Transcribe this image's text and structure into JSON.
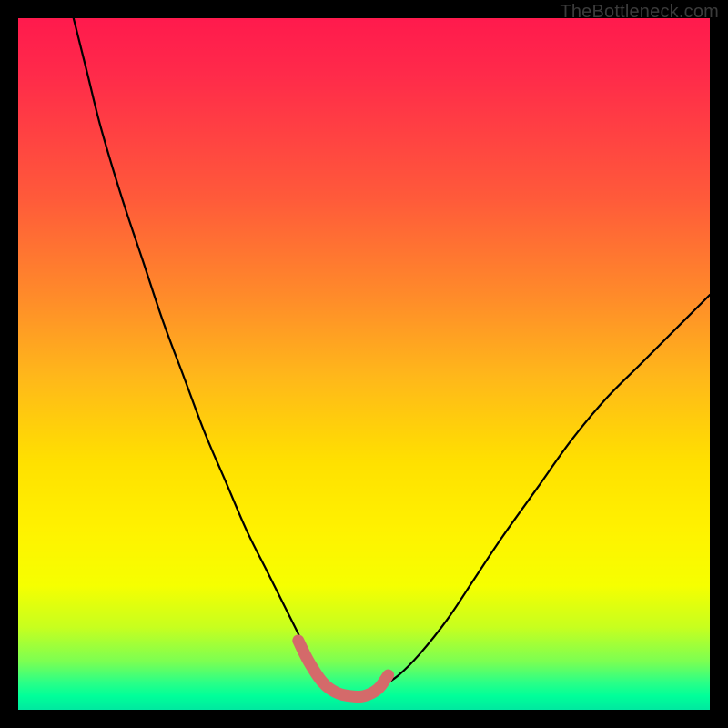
{
  "watermark": "TheBottleneck.com",
  "colors": {
    "curve_stroke": "#000000",
    "highlight_stroke": "#d46a6a",
    "frame_bg": "#000000"
  },
  "chart_data": {
    "type": "line",
    "title": "",
    "xlabel": "",
    "ylabel": "",
    "xlim": [
      0,
      100
    ],
    "ylim": [
      0,
      100
    ],
    "grid": false,
    "legend": false,
    "series": [
      {
        "name": "bottleneck-curve",
        "x": [
          8,
          10,
          12,
          15,
          18,
          21,
          24,
          27,
          30,
          33,
          36,
          38,
          40,
          42,
          44,
          46,
          48,
          50,
          52,
          55,
          58,
          62,
          66,
          70,
          75,
          80,
          85,
          90,
          95,
          100
        ],
        "values": [
          100,
          92,
          84,
          74,
          65,
          56,
          48,
          40,
          33,
          26,
          20,
          16,
          12,
          8,
          5,
          3,
          2,
          2,
          3,
          5,
          8,
          13,
          19,
          25,
          32,
          39,
          45,
          50,
          55,
          60
        ]
      },
      {
        "name": "optimal-range-highlight",
        "x": [
          40.5,
          42,
          44,
          46,
          48,
          50,
          52,
          53.5
        ],
        "values": [
          10,
          7,
          4,
          2.5,
          2,
          2,
          3,
          5
        ]
      }
    ]
  }
}
